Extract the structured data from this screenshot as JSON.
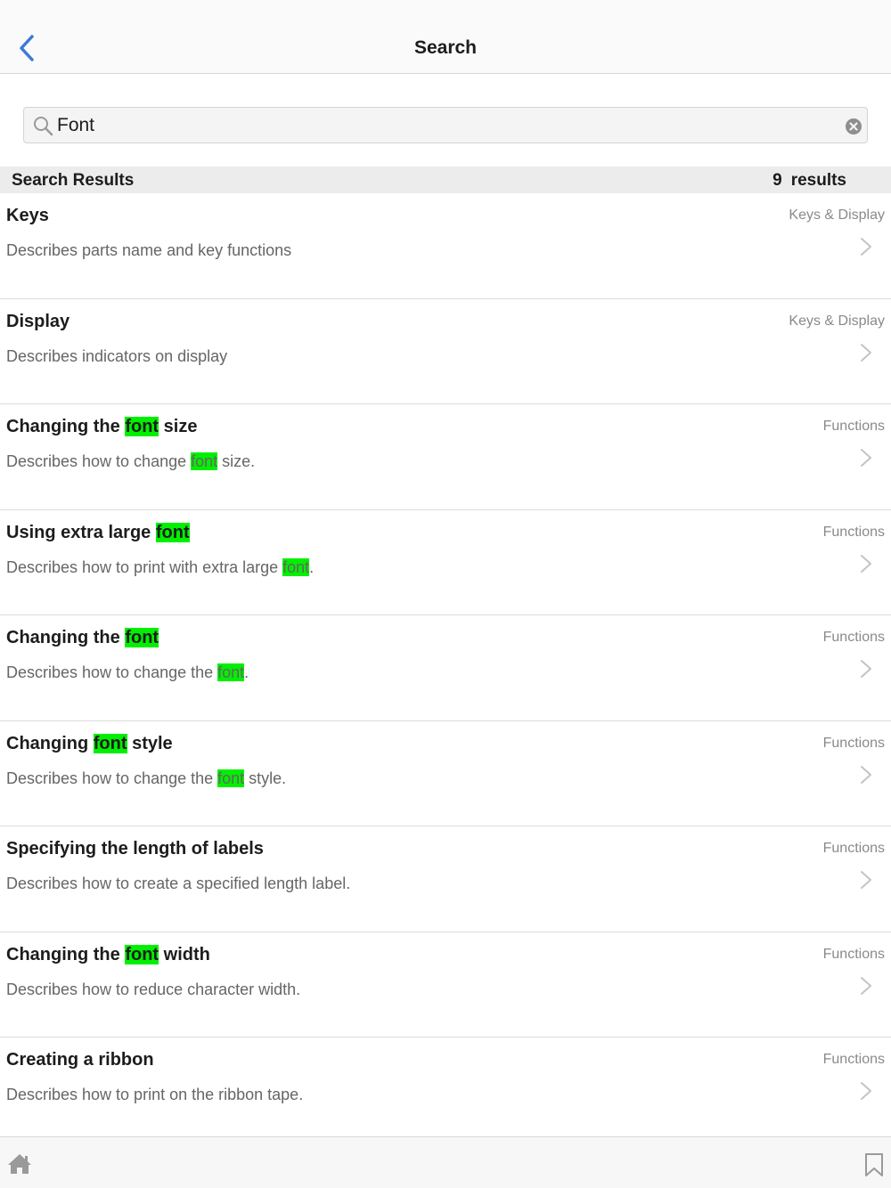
{
  "nav": {
    "title": "Search",
    "back_icon": "chevron-left-icon"
  },
  "search": {
    "value": "Font",
    "placeholder": "",
    "search_icon": "magnifier-icon",
    "clear_icon": "clear-circle-icon"
  },
  "results_header": {
    "title": "Search Results",
    "count": "9",
    "count_label": "results"
  },
  "highlight_color": "#00f000",
  "accent_color": "#3b7bd4",
  "results": [
    {
      "title": [
        {
          "t": "Keys"
        }
      ],
      "desc": [
        {
          "t": "Describes parts name and key functions"
        }
      ],
      "category": "Keys & Display"
    },
    {
      "title": [
        {
          "t": "Display"
        }
      ],
      "desc": [
        {
          "t": "Describes indicators on display"
        }
      ],
      "category": "Keys & Display"
    },
    {
      "title": [
        {
          "t": "Changing the "
        },
        {
          "t": "font",
          "hl": true
        },
        {
          "t": " size"
        }
      ],
      "desc": [
        {
          "t": "Describes how to change "
        },
        {
          "t": "font",
          "hl": true
        },
        {
          "t": " size."
        }
      ],
      "category": "Functions"
    },
    {
      "title": [
        {
          "t": "Using extra large "
        },
        {
          "t": "font",
          "hl": true
        }
      ],
      "desc": [
        {
          "t": "Describes how to print with extra large "
        },
        {
          "t": "font",
          "hl": true
        },
        {
          "t": "."
        }
      ],
      "category": "Functions"
    },
    {
      "title": [
        {
          "t": "Changing the "
        },
        {
          "t": "font",
          "hl": true
        }
      ],
      "desc": [
        {
          "t": "Describes how to change the "
        },
        {
          "t": "font",
          "hl": true
        },
        {
          "t": "."
        }
      ],
      "category": "Functions"
    },
    {
      "title": [
        {
          "t": "Changing "
        },
        {
          "t": "font",
          "hl": true
        },
        {
          "t": " style"
        }
      ],
      "desc": [
        {
          "t": "Describes how to change the "
        },
        {
          "t": "font",
          "hl": true
        },
        {
          "t": " style."
        }
      ],
      "category": "Functions"
    },
    {
      "title": [
        {
          "t": "Specifying the length of labels"
        }
      ],
      "desc": [
        {
          "t": "Describes how to create a specified length label."
        }
      ],
      "category": "Functions"
    },
    {
      "title": [
        {
          "t": "Changing the "
        },
        {
          "t": "font",
          "hl": true
        },
        {
          "t": " width"
        }
      ],
      "desc": [
        {
          "t": "Describes how to reduce character width."
        }
      ],
      "category": "Functions"
    },
    {
      "title": [
        {
          "t": "Creating a ribbon"
        }
      ],
      "desc": [
        {
          "t": "Describes how to print on the ribbon tape."
        }
      ],
      "category": "Functions"
    }
  ],
  "bottom_bar": {
    "home_icon": "home-icon",
    "bookmark_icon": "bookmark-icon"
  }
}
